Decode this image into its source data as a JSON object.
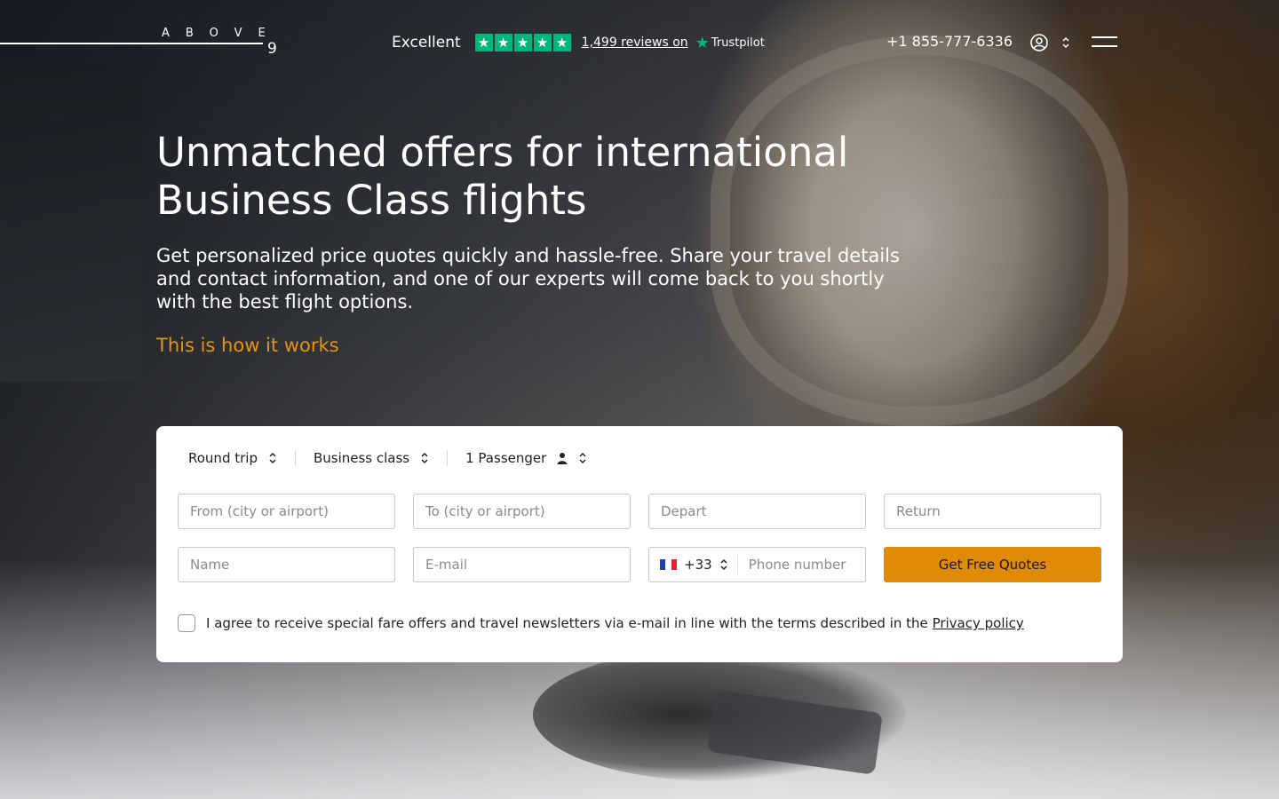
{
  "header": {
    "logo_text": "ABOVE",
    "logo_suffix": "9",
    "trust_label": "Excellent",
    "reviews_link": "1,499 reviews on",
    "trustpilot": "Trustpilot",
    "rating_stars": 5,
    "phone": "+1 855-777-6336"
  },
  "hero": {
    "title": "Unmatched offers for international Business Class flights",
    "subtitle": "Get personalized price quotes quickly and hassle-free. Share your travel details and contact information, and one of our experts will come back to you shortly with the best flight options.",
    "how_link": "This is how it works"
  },
  "form": {
    "trip_type": "Round trip",
    "cabin_class": "Business class",
    "passengers": "1 Passenger",
    "from_placeholder": "From (city or airport)",
    "to_placeholder": "To (city or airport)",
    "depart_placeholder": "Depart",
    "return_placeholder": "Return",
    "name_placeholder": "Name",
    "email_placeholder": "E-mail",
    "dial_code": "+33",
    "phone_placeholder": "Phone number",
    "submit_label": "Get Free Quotes",
    "consent_text": "I agree to receive special fare offers and travel newsletters via e-mail in line with the terms described in the",
    "privacy_link": "Privacy policy"
  },
  "colors": {
    "accent": "#e08a06",
    "link_accent": "#e8920f",
    "trustpilot_green": "#00b67a"
  }
}
